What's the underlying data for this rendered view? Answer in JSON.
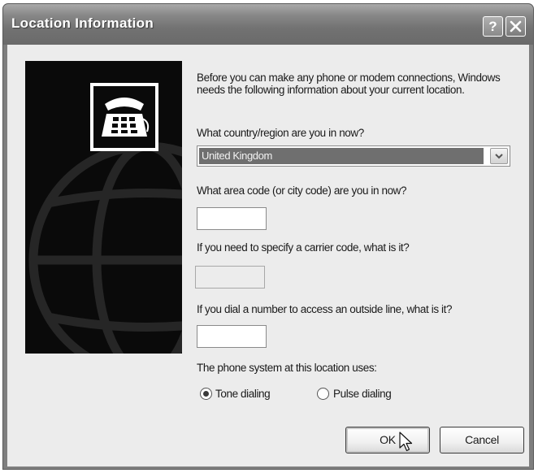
{
  "window": {
    "title": "Location Information",
    "help_label": "?",
    "close_label": "✕"
  },
  "intro": "Before you can make any phone or modem connections, Windows needs the following information about your current location.",
  "country": {
    "label": "What country/region are you in now?",
    "selected": "United Kingdom"
  },
  "area_code": {
    "label": "What area code (or city code) are you in now?",
    "value": ""
  },
  "carrier_code": {
    "label": "If you need to specify a carrier code, what is it?",
    "value": ""
  },
  "outside_line": {
    "label": "If you dial a number to access an outside line, what is it?",
    "value": ""
  },
  "phone_system": {
    "label": "The phone system at this location uses:",
    "options": [
      {
        "label": "Tone dialing",
        "selected": true
      },
      {
        "label": "Pulse dialing",
        "selected": false
      }
    ]
  },
  "buttons": {
    "ok": "OK",
    "cancel": "Cancel"
  },
  "icons": {
    "side_art": "globe-icon",
    "phone": "telephone-icon",
    "dropdown": "chevron-down-icon",
    "cursor": "mouse-pointer-icon"
  }
}
